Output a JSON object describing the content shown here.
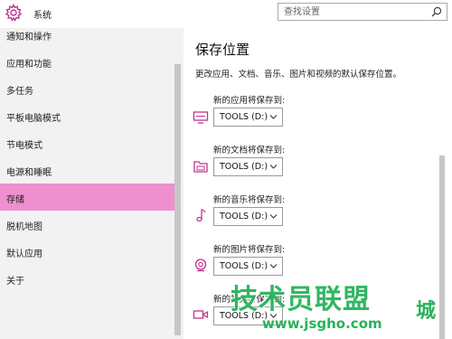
{
  "header": {
    "title": "系统",
    "search_placeholder": "查找设置"
  },
  "sidebar": {
    "items": [
      {
        "label": "通知和操作"
      },
      {
        "label": "应用和功能"
      },
      {
        "label": "多任务"
      },
      {
        "label": "平板电脑模式"
      },
      {
        "label": "节电模式"
      },
      {
        "label": "电源和睡眠"
      },
      {
        "label": "存储"
      },
      {
        "label": "脱机地图"
      },
      {
        "label": "默认应用"
      },
      {
        "label": "关于"
      }
    ],
    "active_index": 6
  },
  "content": {
    "title": "保存位置",
    "description": "更改应用、文档、音乐、图片和视频的默认保存位置。",
    "settings": [
      {
        "label": "新的应用将保存到:",
        "value": "TOOLS (D:)",
        "icon": "monitor-icon"
      },
      {
        "label": "新的文档将保存到:",
        "value": "TOOLS (D:)",
        "icon": "document-folder-icon"
      },
      {
        "label": "新的音乐将保存到:",
        "value": "TOOLS (D:)",
        "icon": "music-note-icon"
      },
      {
        "label": "新的图片将保存到:",
        "value": "TOOLS (D:)",
        "icon": "camera-icon"
      },
      {
        "label": "新的视频将保存到:",
        "value": "TOOLS (D:)",
        "icon": "video-camera-icon"
      }
    ]
  },
  "watermark": {
    "text": "技术员联盟",
    "url": "www.jsgho.com",
    "tail": "城"
  },
  "colors": {
    "accent": "#ee8fcf",
    "icon": "#c2328f",
    "sidebar_bg": "#f2f2f2",
    "watermark": "#27b35a"
  }
}
